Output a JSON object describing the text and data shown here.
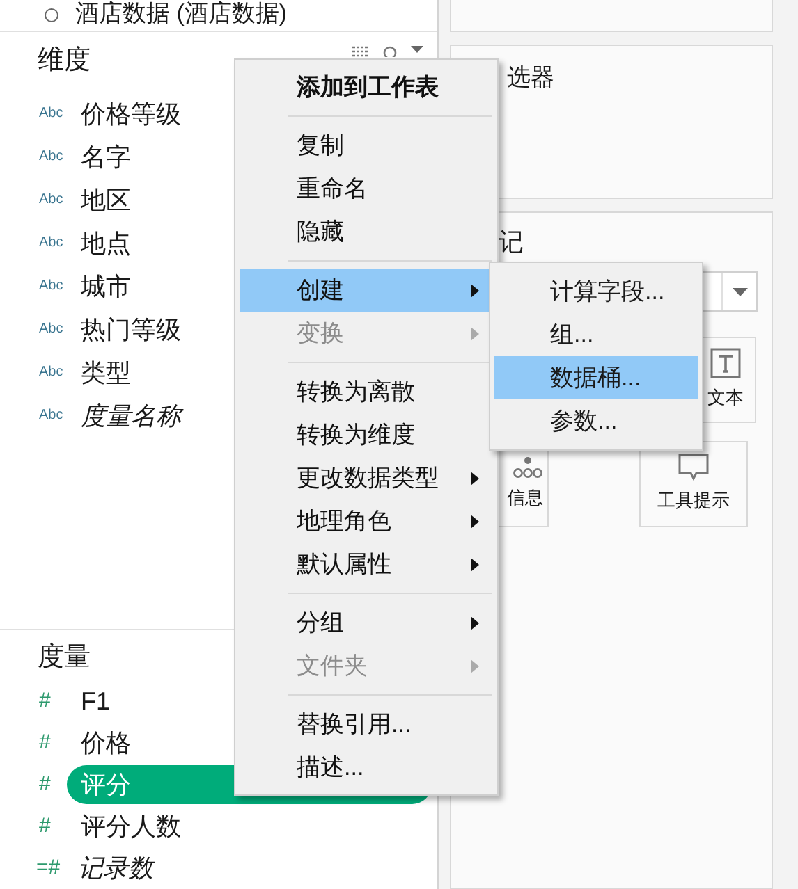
{
  "data_source": {
    "label": "酒店数据 (酒店数据)"
  },
  "dimensions": {
    "title": "维度",
    "items": [
      {
        "icon": "Abc",
        "label": "价格等级",
        "italic": false
      },
      {
        "icon": "Abc",
        "label": "名字",
        "italic": false
      },
      {
        "icon": "Abc",
        "label": "地区",
        "italic": false
      },
      {
        "icon": "Abc",
        "label": "地点",
        "italic": false
      },
      {
        "icon": "Abc",
        "label": "城市",
        "italic": false
      },
      {
        "icon": "Abc",
        "label": "热门等级",
        "italic": false
      },
      {
        "icon": "Abc",
        "label": "类型",
        "italic": false
      },
      {
        "icon": "Abc",
        "label": "度量名称",
        "italic": true
      }
    ]
  },
  "measures": {
    "title": "度量",
    "items": [
      {
        "icon": "#",
        "label": "F1",
        "italic": false,
        "selected": false
      },
      {
        "icon": "#",
        "label": "价格",
        "italic": false,
        "selected": false
      },
      {
        "icon": "#",
        "label": "评分",
        "italic": false,
        "selected": true
      },
      {
        "icon": "#",
        "label": "评分人数",
        "italic": false,
        "selected": false
      },
      {
        "icon": "=#",
        "label": "记录数",
        "italic": true,
        "selected": false
      }
    ]
  },
  "context_menu": [
    {
      "kind": "item",
      "label": "添加到工作表",
      "bold": true,
      "disabled": false,
      "submenu": false,
      "selected": false
    },
    {
      "kind": "separator"
    },
    {
      "kind": "item",
      "label": "复制",
      "bold": false,
      "disabled": false,
      "submenu": false,
      "selected": false
    },
    {
      "kind": "item",
      "label": "重命名",
      "bold": false,
      "disabled": false,
      "submenu": false,
      "selected": false
    },
    {
      "kind": "item",
      "label": "隐藏",
      "bold": false,
      "disabled": false,
      "submenu": false,
      "selected": false
    },
    {
      "kind": "separator"
    },
    {
      "kind": "item",
      "label": "创建",
      "bold": false,
      "disabled": false,
      "submenu": true,
      "selected": true
    },
    {
      "kind": "item",
      "label": "变换",
      "bold": false,
      "disabled": true,
      "submenu": true,
      "selected": false
    },
    {
      "kind": "separator"
    },
    {
      "kind": "item",
      "label": "转换为离散",
      "bold": false,
      "disabled": false,
      "submenu": false,
      "selected": false
    },
    {
      "kind": "item",
      "label": "转换为维度",
      "bold": false,
      "disabled": false,
      "submenu": false,
      "selected": false
    },
    {
      "kind": "item",
      "label": "更改数据类型",
      "bold": false,
      "disabled": false,
      "submenu": true,
      "selected": false
    },
    {
      "kind": "item",
      "label": "地理角色",
      "bold": false,
      "disabled": false,
      "submenu": true,
      "selected": false
    },
    {
      "kind": "item",
      "label": "默认属性",
      "bold": false,
      "disabled": false,
      "submenu": true,
      "selected": false
    },
    {
      "kind": "separator"
    },
    {
      "kind": "item",
      "label": "分组",
      "bold": false,
      "disabled": false,
      "submenu": true,
      "selected": false
    },
    {
      "kind": "item",
      "label": "文件夹",
      "bold": false,
      "disabled": true,
      "submenu": true,
      "selected": false
    },
    {
      "kind": "separator"
    },
    {
      "kind": "item",
      "label": "替换引用...",
      "bold": false,
      "disabled": false,
      "submenu": false,
      "selected": false
    },
    {
      "kind": "item",
      "label": "描述...",
      "bold": false,
      "disabled": false,
      "submenu": false,
      "selected": false
    }
  ],
  "submenu": [
    {
      "label": "计算字段...",
      "selected": false
    },
    {
      "label": "组...",
      "selected": false
    },
    {
      "label": "数据桶...",
      "selected": true
    },
    {
      "label": "参数...",
      "selected": false
    }
  ],
  "filters_card": {
    "title": "选器"
  },
  "marks_card": {
    "title": "记",
    "buttons": [
      {
        "kind": "text",
        "label": "文本"
      },
      {
        "kind": "detail",
        "label": "信息"
      },
      {
        "kind": "tooltip",
        "label": "工具提示"
      }
    ]
  }
}
